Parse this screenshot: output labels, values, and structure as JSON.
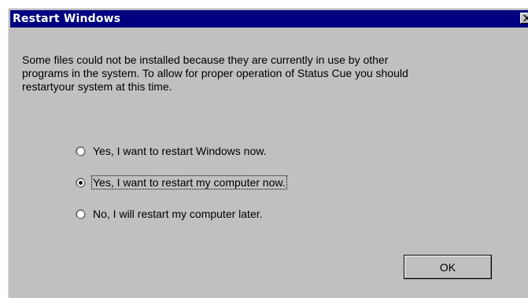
{
  "window": {
    "title": "Restart Windows",
    "titlebar_color": "#000080",
    "face_color": "#c0c0c0",
    "close_icon": "close-icon"
  },
  "message": {
    "line1": "Some files could not be installed because they are currently in use by other",
    "line2": "programs in the system.  To allow for proper operation of Status Cue you should",
    "line3": "restartyour system at this time."
  },
  "options": [
    {
      "label": "Yes, I want to restart Windows now.",
      "selected": false
    },
    {
      "label": "Yes, I want to restart my computer now.",
      "selected": true
    },
    {
      "label": "No, I will restart my computer later.",
      "selected": false
    }
  ],
  "buttons": {
    "ok_label": "OK"
  }
}
